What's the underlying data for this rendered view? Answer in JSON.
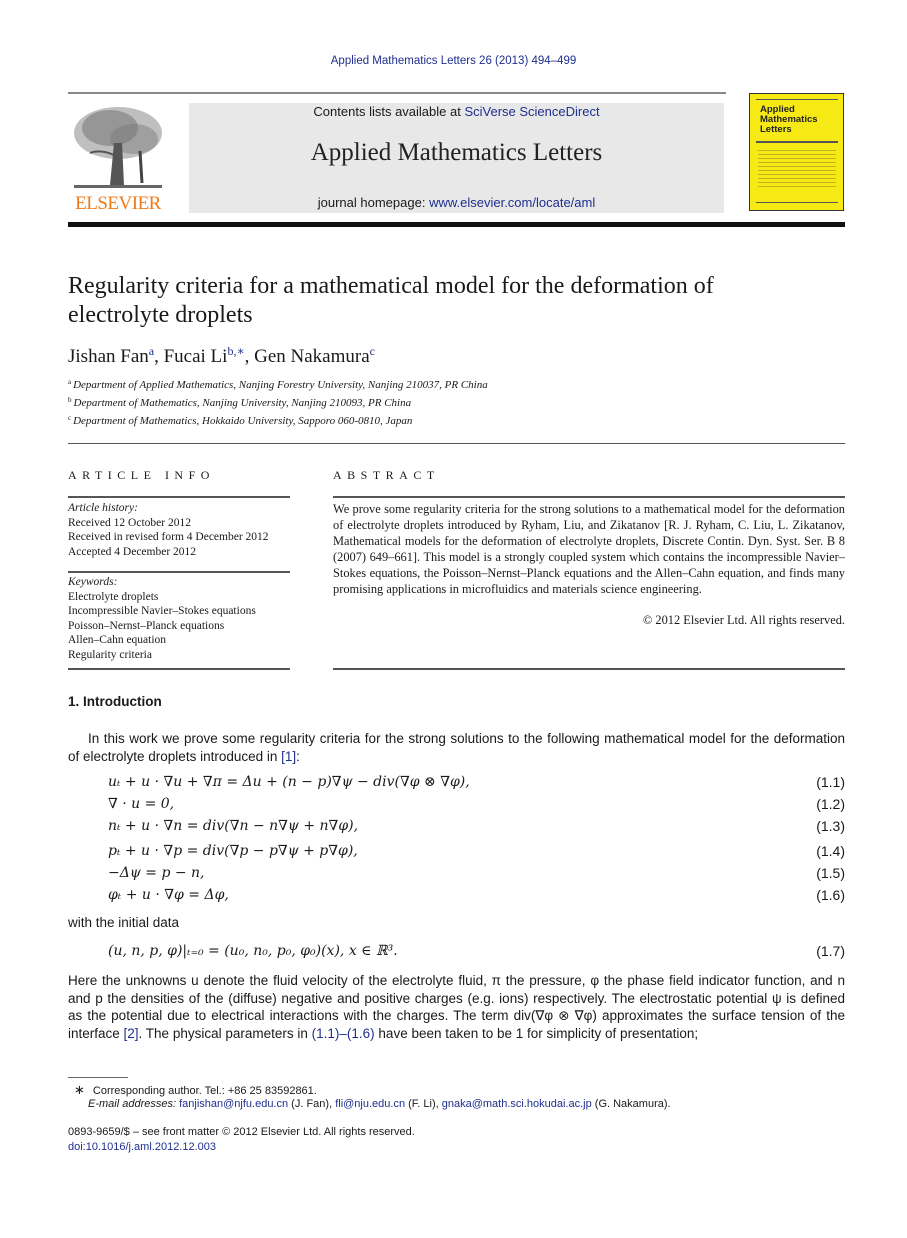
{
  "header": {
    "citation": "Applied Mathematics Letters 26 (2013) 494–499",
    "publisher_logo_text": "ELSEVIER",
    "contents_prefix": "Contents lists available at ",
    "contents_link": "SciVerse ScienceDirect",
    "journal_title": "Applied Mathematics Letters",
    "homepage_prefix": "journal homepage: ",
    "homepage_link": "www.elsevier.com/locate/aml",
    "cover": {
      "line1": "Applied",
      "line2": "Mathematics",
      "line3": "Letters",
      "background": "#f7ea14"
    }
  },
  "article": {
    "title": "Regularity criteria for a mathematical model for the deformation of electrolyte droplets",
    "authors": [
      {
        "name": "Jishan Fan",
        "sup": "a"
      },
      {
        "name": "Fucai Li",
        "sup": "b,∗"
      },
      {
        "name": "Gen Nakamura",
        "sup": "c"
      }
    ],
    "affiliations": [
      {
        "key": "a",
        "text": "Department of Applied Mathematics, Nanjing Forestry University, Nanjing 210037, PR China"
      },
      {
        "key": "b",
        "text": "Department of Mathematics, Nanjing University, Nanjing 210093, PR China"
      },
      {
        "key": "c",
        "text": "Department of Mathematics, Hokkaido University, Sapporo 060-0810, Japan"
      }
    ]
  },
  "article_info": {
    "heading": "ARTICLE INFO",
    "history_label": "Article history:",
    "history": [
      "Received 12 October 2012",
      "Received in revised form 4 December 2012",
      "Accepted 4 December 2012"
    ],
    "keywords_label": "Keywords:",
    "keywords": [
      "Electrolyte droplets",
      "Incompressible Navier–Stokes equations",
      "Poisson–Nernst–Planck equations",
      "Allen–Cahn equation",
      "Regularity criteria"
    ]
  },
  "abstract": {
    "heading": "ABSTRACT",
    "text": "We prove some regularity criteria for the strong solutions to a mathematical model for the deformation of electrolyte droplets introduced by Ryham, Liu, and Zikatanov [R. J. Ryham, C. Liu, L. Zikatanov, Mathematical models for the deformation of electrolyte droplets, Discrete Contin. Dyn. Syst. Ser. B 8 (2007) 649–661]. This model is a strongly coupled system which contains the incompressible Navier–Stokes equations, the Poisson–Nernst–Planck equations and the Allen–Cahn equation, and finds many promising applications in microfluidics and materials science engineering.",
    "copyright": "© 2012 Elsevier Ltd. All rights reserved."
  },
  "body": {
    "section_heading": "1.  Introduction",
    "para1_text": "In this work we prove some regularity criteria for the strong solutions to the following mathematical model for the deformation of electrolyte droplets introduced in ",
    "para1_ref": "[1]",
    "para1_end": ":",
    "equations": [
      {
        "tex": "uₜ + u · ∇u + ∇π = Δu + (n − p)∇ψ − div(∇φ ⊗ ∇φ),",
        "num": "(1.1)"
      },
      {
        "tex": "∇ · u = 0,",
        "num": "(1.2)"
      },
      {
        "tex": "nₜ + u · ∇n = div(∇n − n∇ψ + n∇φ),",
        "num": "(1.3)"
      },
      {
        "tex": "pₜ + u · ∇p = div(∇p − p∇ψ + p∇φ),",
        "num": "(1.4)"
      },
      {
        "tex": "−Δψ = p − n,",
        "num": "(1.5)"
      },
      {
        "tex": "φₜ + u · ∇φ = Δφ,",
        "num": "(1.6)"
      }
    ],
    "initial_data_label": "with the initial data",
    "initial_equation": {
      "tex": "(u, n, p, φ)|ₜ₌₀ = (u₀, n₀, p₀, φ₀)(x),    x ∈ ℝ³.",
      "num": "(1.7)"
    },
    "para2_a": "Here the unknowns u denote the fluid velocity of the electrolyte fluid, π the pressure, φ the phase field indicator function, and n and p the densities of the (diffuse) negative and positive charges (e.g. ions) respectively. The electrostatic potential ψ is defined as the potential due to electrical interactions with the charges. The term div(∇φ ⊗ ∇φ) approximates the surface tension of the interface ",
    "para2_ref1": "[2]",
    "para2_b": ". The physical parameters in ",
    "para2_ref2": "(1.1)–(1.6)",
    "para2_c": " have been taken to be 1 for simplicity of presentation;"
  },
  "footnotes": {
    "star": "∗",
    "corresponding": "Corresponding author. Tel.: +86 25 83592861.",
    "email_label": "E-mail addresses: ",
    "emails": [
      {
        "email": "fanjishan@njfu.edu.cn",
        "who": " (J. Fan), "
      },
      {
        "email": "fli@nju.edu.cn",
        "who": " (F. Li), "
      },
      {
        "email": "gnaka@math.sci.hokudai.ac.jp",
        "who": " (G. Nakamura)."
      }
    ],
    "front_matter": "0893-9659/$ – see front matter © 2012 Elsevier Ltd. All rights reserved.",
    "doi": "doi:10.1016/j.aml.2012.12.003"
  }
}
